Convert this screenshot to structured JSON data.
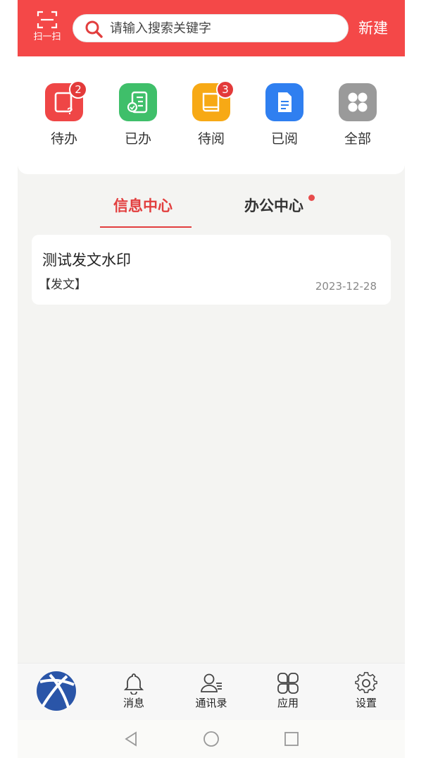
{
  "header": {
    "scan_label": "扫一扫",
    "search_placeholder": "请输入搜索关键字",
    "new_label": "新建",
    "bg_color": "#f44848"
  },
  "quick_menu": {
    "items": [
      {
        "label": "待办",
        "badge": "2",
        "color": "#ef4646",
        "icon": "todo-icon"
      },
      {
        "label": "已办",
        "badge": "",
        "color": "#3fbf6a",
        "icon": "done-icon"
      },
      {
        "label": "待阅",
        "badge": "3",
        "color": "#f7a915",
        "icon": "to-read-icon"
      },
      {
        "label": "已阅",
        "badge": "",
        "color": "#2f7ff0",
        "icon": "read-icon"
      },
      {
        "label": "全部",
        "badge": "",
        "color": "#9a9a9a",
        "icon": "all-icon"
      }
    ]
  },
  "tabs": {
    "items": [
      {
        "label": "信息中心",
        "active": true
      },
      {
        "label": "办公中心",
        "active": false,
        "dot": true
      }
    ],
    "accent_color": "#e23e3e"
  },
  "list": {
    "items": [
      {
        "title": "测试发文水印",
        "tag": "【发文】",
        "date": "2023-12-28"
      }
    ]
  },
  "bottom_nav": {
    "items": [
      {
        "label": "消息",
        "icon": "bell-icon"
      },
      {
        "label": "通讯录",
        "icon": "contacts-icon"
      },
      {
        "label": "应用",
        "icon": "apps-icon"
      },
      {
        "label": "设置",
        "icon": "gear-icon"
      }
    ]
  }
}
